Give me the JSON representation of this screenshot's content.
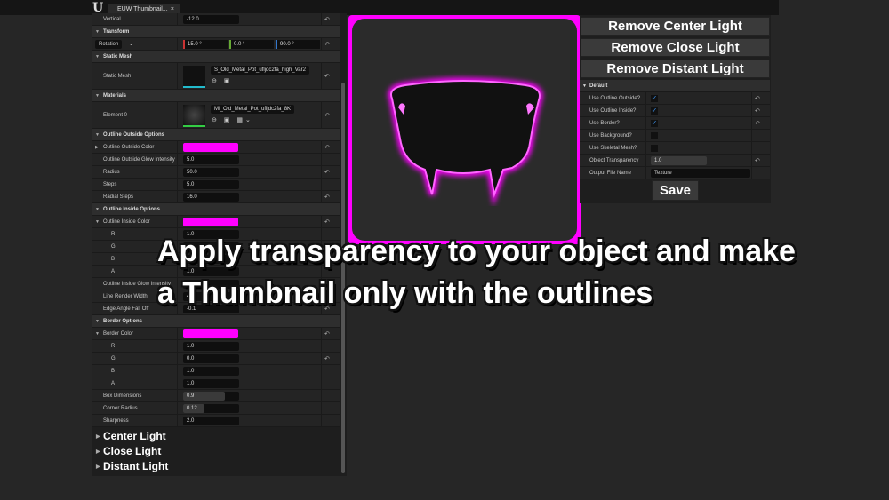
{
  "tab": {
    "title": "EUW Thumbnail...",
    "close": "×"
  },
  "left_rows": [
    {
      "type": "prop",
      "label": "Vertical",
      "value": "-12.0",
      "reset": true
    },
    {
      "type": "header",
      "label": "Transform"
    },
    {
      "type": "rotation",
      "label": "Rotation",
      "values": [
        "15.0 °",
        "0.0 °",
        "90.0 °"
      ],
      "reset": true
    },
    {
      "type": "header",
      "label": "Static Mesh"
    },
    {
      "type": "mesh",
      "label": "Static Mesh",
      "asset": "S_Old_Metal_Pot_ufljdc2fa_high_Var2",
      "reset": true
    },
    {
      "type": "header",
      "label": "Materials"
    },
    {
      "type": "mesh",
      "label": "Element 0",
      "asset": "MI_Old_Metal_Pot_ufljdc2fa_8K",
      "reset": true,
      "material": true
    },
    {
      "type": "header",
      "label": "Outline Outside Options"
    },
    {
      "type": "color",
      "label": "Outline Outside Color",
      "reset": true,
      "collapsed": true,
      "color": "#ff00ff"
    },
    {
      "type": "prop",
      "label": "Outline Outside Glow Intensity",
      "value": "5.0"
    },
    {
      "type": "prop",
      "label": "Radius",
      "value": "50.0",
      "reset": true
    },
    {
      "type": "prop",
      "label": "Steps",
      "value": "5.0"
    },
    {
      "type": "prop",
      "label": "Radial Steps",
      "value": "16.0",
      "reset": true
    },
    {
      "type": "header",
      "label": "Outline Inside Options"
    },
    {
      "type": "color",
      "label": "Outline Inside Color",
      "reset": true,
      "color": "#ff00ff"
    },
    {
      "type": "sub",
      "label": "R",
      "value": "1.0"
    },
    {
      "type": "sub",
      "label": "G",
      "value": ""
    },
    {
      "type": "sub",
      "label": "B",
      "value": ""
    },
    {
      "type": "sub",
      "label": "A",
      "value": "1.0"
    },
    {
      "type": "prop",
      "label": "Outline Inside Glow Intensity",
      "value": "1"
    },
    {
      "type": "prop",
      "label": "Line Render Width",
      "value": "4"
    },
    {
      "type": "slider",
      "label": "Edge Angle Fall Off",
      "value": "-0.1",
      "fraction": 0,
      "reset": true
    },
    {
      "type": "header",
      "label": "Border Options"
    },
    {
      "type": "color",
      "label": "Border Color",
      "reset": true,
      "color": "#ff00ff"
    },
    {
      "type": "sub",
      "label": "R",
      "value": "1.0"
    },
    {
      "type": "sub",
      "label": "G",
      "value": "0.0",
      "reset": true
    },
    {
      "type": "sub",
      "label": "B",
      "value": "1.0"
    },
    {
      "type": "sub",
      "label": "A",
      "value": "1.0"
    },
    {
      "type": "slider",
      "label": "Box Dimensions",
      "value": "0.9",
      "fraction": 0.75
    },
    {
      "type": "slider",
      "label": "Corner Radius",
      "value": "0.12",
      "fraction": 0.38
    },
    {
      "type": "prop",
      "label": "Sharpness",
      "value": "2.0"
    }
  ],
  "lights": [
    "Center Light",
    "Close Light",
    "Distant Light"
  ],
  "right": {
    "buttons": [
      "Remove Center Light",
      "Remove Close Light",
      "Remove Distant Light"
    ],
    "section": "Default",
    "rows": [
      {
        "label": "Use Outline Outside?",
        "checked": true,
        "reset": true
      },
      {
        "label": "Use Outline Inside?",
        "checked": true,
        "reset": true
      },
      {
        "label": "Use Border?",
        "checked": true,
        "reset": true
      },
      {
        "label": "Use Background?",
        "checked": false
      },
      {
        "label": "Use Skeletal Mesh?",
        "checked": false
      }
    ],
    "transparency_label": "Object Transparency",
    "transparency_value": "1.0",
    "filename_label": "Output File Name",
    "filename_value": "Texture",
    "save": "Save"
  },
  "caption": {
    "line1": "Apply transparency to your object and make",
    "line2": "a Thumbnail only with the outlines"
  },
  "colors": {
    "accent": "#ff00ff",
    "check": "#3a8ee6"
  }
}
